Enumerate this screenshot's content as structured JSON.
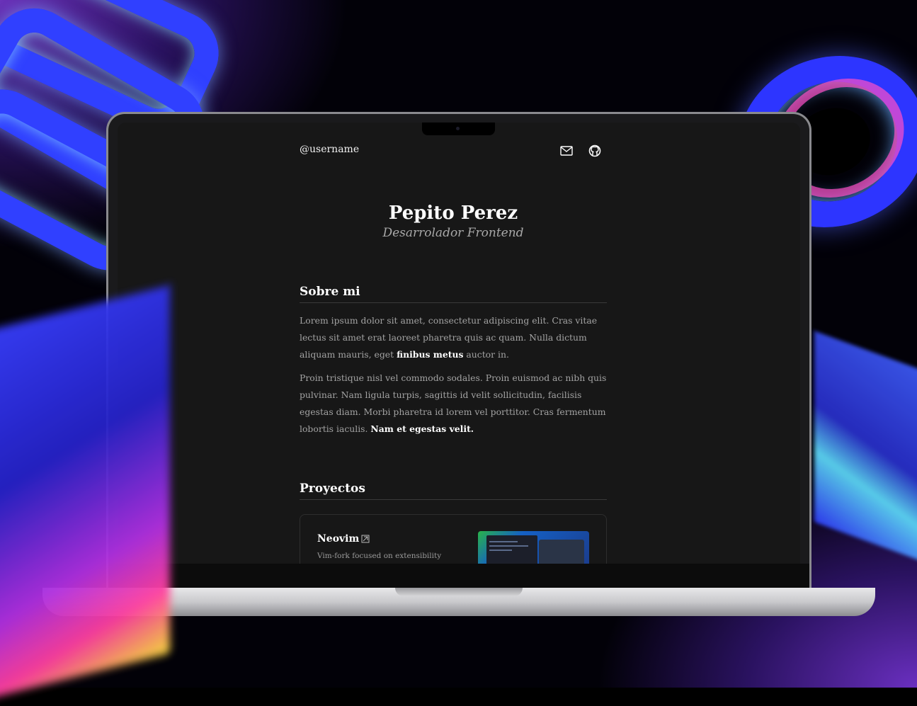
{
  "site": {
    "username": "@username",
    "name": "Pepito Perez",
    "role": "Desarrolador Frontend",
    "about": {
      "title": "Sobre mi",
      "p1_before": "Lorem ipsum dolor sit amet, consectetur adipiscing elit. Cras vitae lectus sit amet erat laoreet pharetra quis ac quam. Nulla dictum aliquam mauris, eget ",
      "p1_highlight": "finibus metus",
      "p1_after": " auctor in.",
      "p2_before": "Proin tristique nisl vel commodo sodales. Proin euismod ac nibh quis pulvinar. Nam ligula turpis, sagittis id velit sollicitudin, facilisis egestas diam. Morbi pharetra id lorem vel porttitor. Cras fermentum lobortis iaculis. ",
      "p2_highlight": "Nam et egestas velit."
    },
    "projects": {
      "title": "Proyectos",
      "items": [
        {
          "name": "Neovim",
          "description": "Vim-fork focused on extensibility",
          "icon": "external-link-icon"
        }
      ]
    },
    "nav_icons": [
      "mail-icon",
      "github-icon"
    ]
  },
  "colors": {
    "background": "#171717",
    "text": "#ffffff",
    "muted": "#a3a3a3"
  }
}
